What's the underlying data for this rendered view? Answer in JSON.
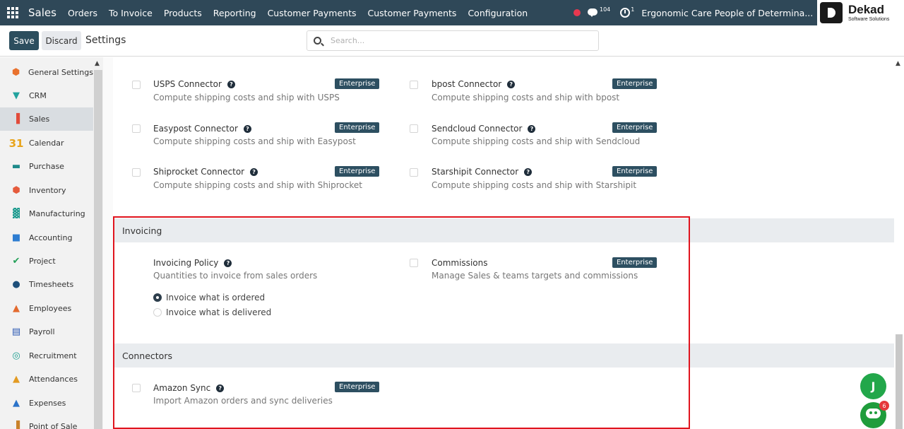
{
  "navbar": {
    "app_name": "Sales",
    "menu": [
      "Orders",
      "To Invoice",
      "Products",
      "Reporting",
      "Customer Payments",
      "Customer Payments",
      "Configuration"
    ],
    "message_count": "104",
    "activity_count": "1",
    "company": "Ergonomic Care People of Determina...",
    "user_initial": "D"
  },
  "brand_logo": {
    "name": "Dekad",
    "subtitle": "Software Solutions"
  },
  "control_panel": {
    "save_label": "Save",
    "discard_label": "Discard",
    "title": "Settings",
    "search_placeholder": "Search..."
  },
  "sidebar": {
    "items": [
      {
        "label": "General Settings",
        "icon": "settings-icon",
        "color": "#e9722e"
      },
      {
        "label": "CRM",
        "icon": "crm-icon",
        "color": "#22a39e"
      },
      {
        "label": "Sales",
        "icon": "sales-icon",
        "color": "#e24b3a",
        "active": true
      },
      {
        "label": "Calendar",
        "icon": "calendar-icon",
        "color": "#e8a41c"
      },
      {
        "label": "Purchase",
        "icon": "purchase-icon",
        "color": "#1e8a8a"
      },
      {
        "label": "Inventory",
        "icon": "inventory-icon",
        "color": "#e55b3c"
      },
      {
        "label": "Manufacturing",
        "icon": "manufacturing-icon",
        "color": "#1f9b8f"
      },
      {
        "label": "Accounting",
        "icon": "accounting-icon",
        "color": "#2e7dd1"
      },
      {
        "label": "Project",
        "icon": "project-icon",
        "color": "#24a059"
      },
      {
        "label": "Timesheets",
        "icon": "timesheets-icon",
        "color": "#1e4f7a"
      },
      {
        "label": "Employees",
        "icon": "employees-icon",
        "color": "#e36a2e"
      },
      {
        "label": "Payroll",
        "icon": "payroll-icon",
        "color": "#2b58b3"
      },
      {
        "label": "Recruitment",
        "icon": "recruitment-icon",
        "color": "#1a9d8f"
      },
      {
        "label": "Attendances",
        "icon": "attendances-icon",
        "color": "#e39a22"
      },
      {
        "label": "Expenses",
        "icon": "expenses-icon",
        "color": "#2b73c9"
      },
      {
        "label": "Point of Sale",
        "icon": "pos-icon",
        "color": "#c9822b"
      }
    ]
  },
  "shipping": [
    {
      "title": "USPS Connector",
      "desc": "Compute shipping costs and ship with USPS",
      "badge": "Enterprise"
    },
    {
      "title": "bpost Connector",
      "desc": "Compute shipping costs and ship with bpost",
      "badge": "Enterprise"
    },
    {
      "title": "Easypost Connector",
      "desc": "Compute shipping costs and ship with Easypost",
      "badge": "Enterprise"
    },
    {
      "title": "Sendcloud Connector",
      "desc": "Compute shipping costs and ship with Sendcloud",
      "badge": "Enterprise"
    },
    {
      "title": "Shiprocket Connector",
      "desc": "Compute shipping costs and ship with Shiprocket",
      "badge": "Enterprise"
    },
    {
      "title": "Starshipit Connector",
      "desc": "Compute shipping costs and ship with Starshipit",
      "badge": "Enterprise"
    }
  ],
  "invoicing": {
    "section_title": "Invoicing",
    "policy_title": "Invoicing Policy",
    "policy_desc": "Quantities to invoice from sales orders",
    "option_ordered": "Invoice what is ordered",
    "option_delivered": "Invoice what is delivered",
    "selected": "ordered",
    "commissions_title": "Commissions",
    "commissions_desc": "Manage Sales & teams targets and commissions",
    "commissions_badge": "Enterprise"
  },
  "connectors": {
    "section_title": "Connectors",
    "amazon_title": "Amazon Sync",
    "amazon_desc": "Import Amazon orders and sync deliveries",
    "amazon_badge": "Enterprise"
  },
  "chat": {
    "avatar_initial": "J",
    "bot_badge": "6"
  }
}
